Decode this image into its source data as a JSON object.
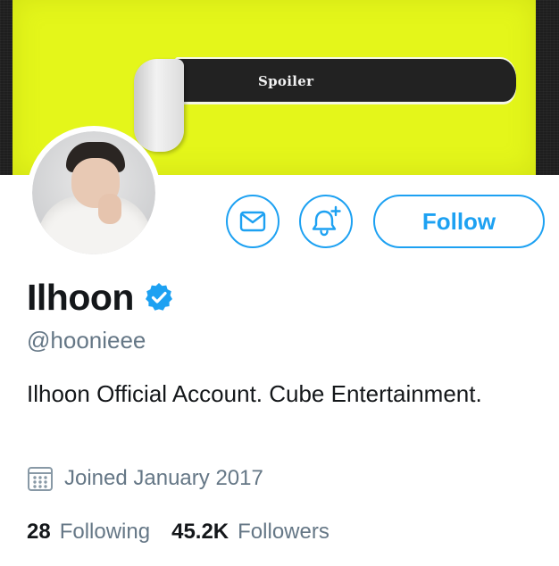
{
  "banner": {
    "text": "Spoiler"
  },
  "profile": {
    "display_name": "Ilhoon",
    "handle": "@hoonieee",
    "bio": "Ilhoon Official Account. Cube Entertainment.",
    "joined": "Joined January 2017",
    "verified": true
  },
  "actions": {
    "follow_label": "Follow",
    "message_icon": "envelope-icon",
    "notify_icon": "bell-plus-icon"
  },
  "stats": {
    "following_count": "28",
    "following_label": "Following",
    "followers_count": "45.2K",
    "followers_label": "Followers"
  },
  "colors": {
    "accent": "#1da1f2",
    "secondary_text": "#657786",
    "primary_text": "#14171a",
    "banner_yellow": "#e4f61a"
  }
}
